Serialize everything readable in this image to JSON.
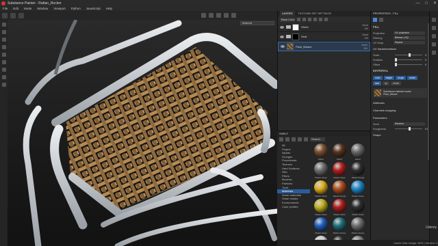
{
  "window": {
    "title": "Substance Painter - Rattan_Rocker",
    "controls": [
      "—",
      "□",
      "✕"
    ]
  },
  "menu": [
    "File",
    "Edit",
    "Mode",
    "Window",
    "Viewport",
    "Python",
    "JavaScript",
    "Help"
  ],
  "viewport": {
    "material_select": "Material"
  },
  "layers": {
    "tabs": [
      "LAYERS",
      "TEXTURE SET SETTINGS"
    ],
    "channel_select": "Base Color",
    "items": [
      {
        "name": "Globe",
        "blend": "Norm",
        "opacity": "100",
        "thumb": "white",
        "folder": true
      },
      {
        "name": "Seat",
        "blend": "Norm",
        "opacity": "100",
        "thumb": "black",
        "folder": true
      },
      {
        "name": "Plain_Weave",
        "blend": "Norm",
        "opacity": "100",
        "thumb": "wood",
        "folder": false
      }
    ]
  },
  "properties": {
    "header": "PROPERTIES - FILL",
    "fill": {
      "title": "FILL",
      "projection_label": "Projection",
      "projection_value": "UV projection",
      "filtering_label": "Filtering",
      "filtering_value": "Bilinear | HQ",
      "uvwrap_label": "UV Wrap",
      "uvwrap_value": "Repeat"
    },
    "uv": {
      "title": "UV transformations",
      "scale_label": "Scale",
      "scale_value": "3",
      "rotation_label": "Rotation",
      "rotation_value": "0",
      "offset_label": "Offset",
      "offset_value": "0"
    },
    "material": {
      "title": "MATERIAL",
      "chips": [
        {
          "label": "color",
          "on": true
        },
        {
          "label": "height",
          "on": true
        },
        {
          "label": "rough",
          "on": true
        },
        {
          "label": "metal",
          "on": true
        },
        {
          "label": "nrm",
          "on": true
        },
        {
          "label": "op",
          "on": false
        },
        {
          "label": "emiss",
          "on": false
        }
      ],
      "card_title": "Substance material model",
      "card_subtitle": "Plain_Weave"
    },
    "sections": [
      "Attributes",
      "Channels mapping",
      "Parameters"
    ],
    "params": {
      "seed_label": "Seed",
      "seed_value": "Random",
      "roughness_label": "Roughness",
      "roughness_value": "0.5"
    },
    "shape_label": "Shape"
  },
  "shelf": {
    "header": "SHELF",
    "search": "Search",
    "categories": [
      "All",
      "Project",
      "Alphas",
      "Grunges",
      "Procedurals",
      "Textures",
      "Hard Surfaces",
      "Skin",
      "Filters",
      "Brushes",
      "Particles",
      "Tools",
      "Materials",
      "Smart materials",
      "Smart masks",
      "Environments",
      "Color profiles"
    ],
    "active_category": "Materials",
    "materials": [
      {
        "name": "Fabric",
        "color": "#7a5030"
      },
      {
        "name": "Fabric",
        "color": "#5a3420"
      },
      {
        "name": "Fabric",
        "color": "#6b6b6b"
      },
      {
        "name": "Plastic Gloss",
        "color": "#6e6e6e"
      },
      {
        "name": "Plastic Gloss",
        "color": "#b32020"
      },
      {
        "name": "Plastic Rough",
        "color": "#303030"
      },
      {
        "name": "Plastic Gloss",
        "color": "#e0b020"
      },
      {
        "name": "Plastic Rough",
        "color": "#b05020"
      },
      {
        "name": "Plastic Gloss",
        "color": "#2088c8"
      },
      {
        "name": "Plastic Gloss",
        "color": "#c0b020"
      },
      {
        "name": "Plastic Gloss",
        "color": "#b02020"
      },
      {
        "name": "Plastic Gloss",
        "color": "#2f2f2f"
      },
      {
        "name": "Plastic Gloss",
        "color": "#2060c0"
      },
      {
        "name": "Plastic Glossy",
        "color": "#20707a"
      },
      {
        "name": "Plastic Glossy",
        "color": "#707070"
      },
      {
        "name": "",
        "color": "#d0d0d0"
      },
      {
        "name": "",
        "color": "#303030"
      },
      {
        "name": "",
        "color": "#808080"
      }
    ]
  },
  "status": {
    "text": "Cache Disk Usage: 82% | Version: 2.x"
  },
  "watermark": "Udemy"
}
